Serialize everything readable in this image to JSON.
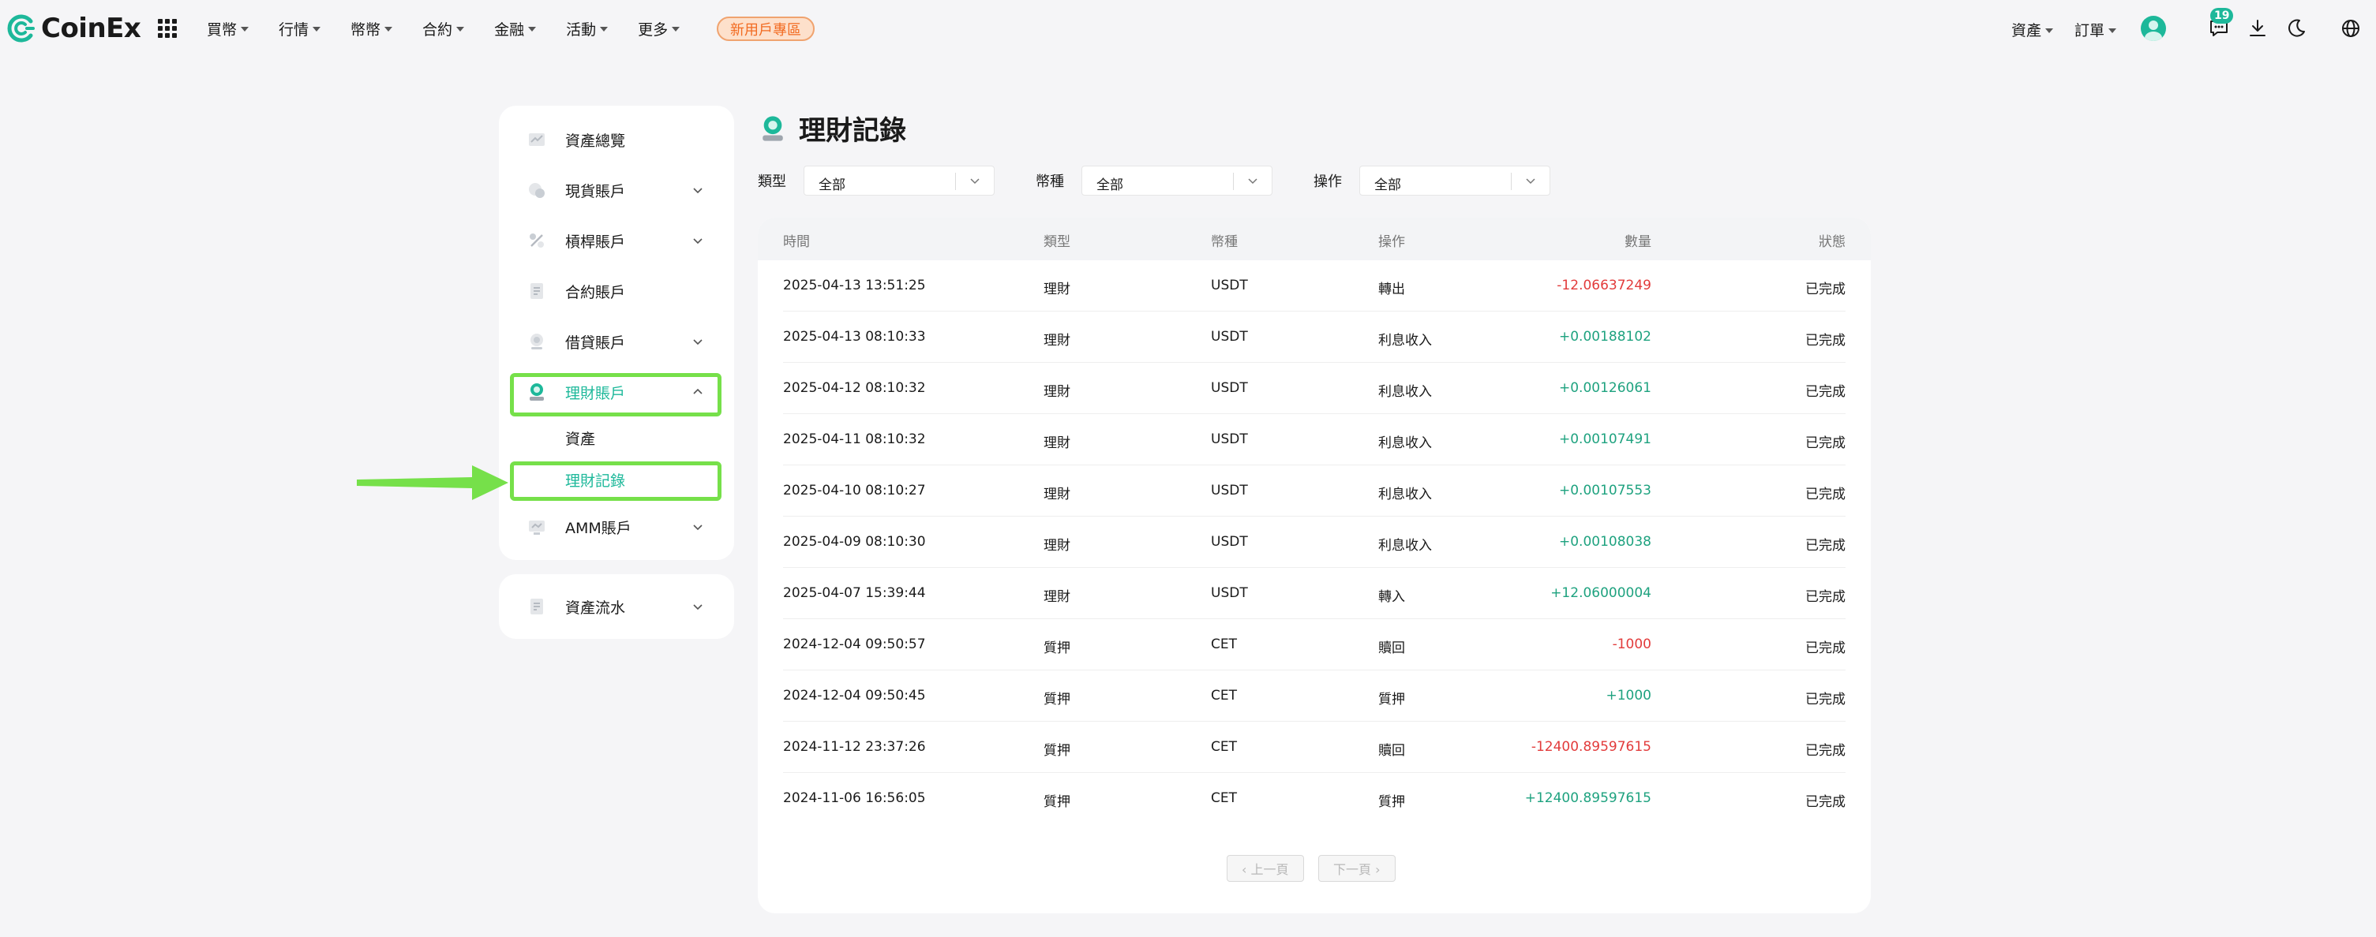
{
  "brand": {
    "name": "CoinEx",
    "accent": "#1db89a"
  },
  "nav": {
    "items": [
      {
        "label": "買幣"
      },
      {
        "label": "行情"
      },
      {
        "label": "幣幣"
      },
      {
        "label": "合約"
      },
      {
        "label": "金融"
      },
      {
        "label": "活動"
      },
      {
        "label": "更多"
      }
    ],
    "promo": "新用戶專區",
    "right": {
      "assets": "資產",
      "orders": "訂單",
      "notification_count": "19"
    },
    "icons": [
      "apps-grid-icon",
      "avatar",
      "message-icon",
      "download-icon",
      "moon-icon",
      "globe-icon"
    ]
  },
  "sidebar": {
    "items": [
      {
        "label": "資產總覽",
        "icon": "overview-icon"
      },
      {
        "label": "現貨賬戶",
        "icon": "spot-icon"
      },
      {
        "label": "槓桿賬戶",
        "icon": "margin-icon"
      },
      {
        "label": "合約賬戶",
        "icon": "futures-icon"
      },
      {
        "label": "借貸賬戶",
        "icon": "loan-icon"
      },
      {
        "label": "理財賬戶",
        "icon": "financial-icon"
      },
      {
        "label": "AMM賬戶",
        "icon": "amm-icon"
      }
    ],
    "sub_items": [
      {
        "label": "資產"
      },
      {
        "label": "理財記錄"
      }
    ],
    "flow": {
      "label": "資產流水",
      "icon": "ledger-icon"
    }
  },
  "main": {
    "title": "理財記錄",
    "filters": [
      {
        "label": "類型",
        "value": "全部"
      },
      {
        "label": "幣種",
        "value": "全部"
      },
      {
        "label": "操作",
        "value": "全部"
      }
    ],
    "table": {
      "columns": [
        "時間",
        "類型",
        "幣種",
        "操作",
        "數量",
        "狀態"
      ],
      "rows": [
        {
          "time": "2025-04-13 13:51:25",
          "type": "理財",
          "coin": "USDT",
          "op": "轉出",
          "amount": "-12.06637249",
          "status": "已完成"
        },
        {
          "time": "2025-04-13 08:10:33",
          "type": "理財",
          "coin": "USDT",
          "op": "利息收入",
          "amount": "+0.00188102",
          "status": "已完成"
        },
        {
          "time": "2025-04-12 08:10:32",
          "type": "理財",
          "coin": "USDT",
          "op": "利息收入",
          "amount": "+0.00126061",
          "status": "已完成"
        },
        {
          "time": "2025-04-11 08:10:32",
          "type": "理財",
          "coin": "USDT",
          "op": "利息收入",
          "amount": "+0.00107491",
          "status": "已完成"
        },
        {
          "time": "2025-04-10 08:10:27",
          "type": "理財",
          "coin": "USDT",
          "op": "利息收入",
          "amount": "+0.00107553",
          "status": "已完成"
        },
        {
          "time": "2025-04-09 08:10:30",
          "type": "理財",
          "coin": "USDT",
          "op": "利息收入",
          "amount": "+0.00108038",
          "status": "已完成"
        },
        {
          "time": "2025-04-07 15:39:44",
          "type": "理財",
          "coin": "USDT",
          "op": "轉入",
          "amount": "+12.06000004",
          "status": "已完成"
        },
        {
          "time": "2024-12-04 09:50:57",
          "type": "質押",
          "coin": "CET",
          "op": "贖回",
          "amount": "-1000",
          "status": "已完成"
        },
        {
          "time": "2024-12-04 09:50:45",
          "type": "質押",
          "coin": "CET",
          "op": "質押",
          "amount": "+1000",
          "status": "已完成"
        },
        {
          "time": "2024-11-12 23:37:26",
          "type": "質押",
          "coin": "CET",
          "op": "贖回",
          "amount": "-12400.89597615",
          "status": "已完成"
        },
        {
          "time": "2024-11-06 16:56:05",
          "type": "質押",
          "coin": "CET",
          "op": "質押",
          "amount": "+12400.89597615",
          "status": "已完成"
        }
      ]
    },
    "pager": {
      "prev": "‹ 上一頁",
      "next": "下一頁 ›"
    }
  },
  "colors": {
    "positive": "#1ea27f",
    "negative": "#e23b3b",
    "highlight": "#76e04a"
  }
}
